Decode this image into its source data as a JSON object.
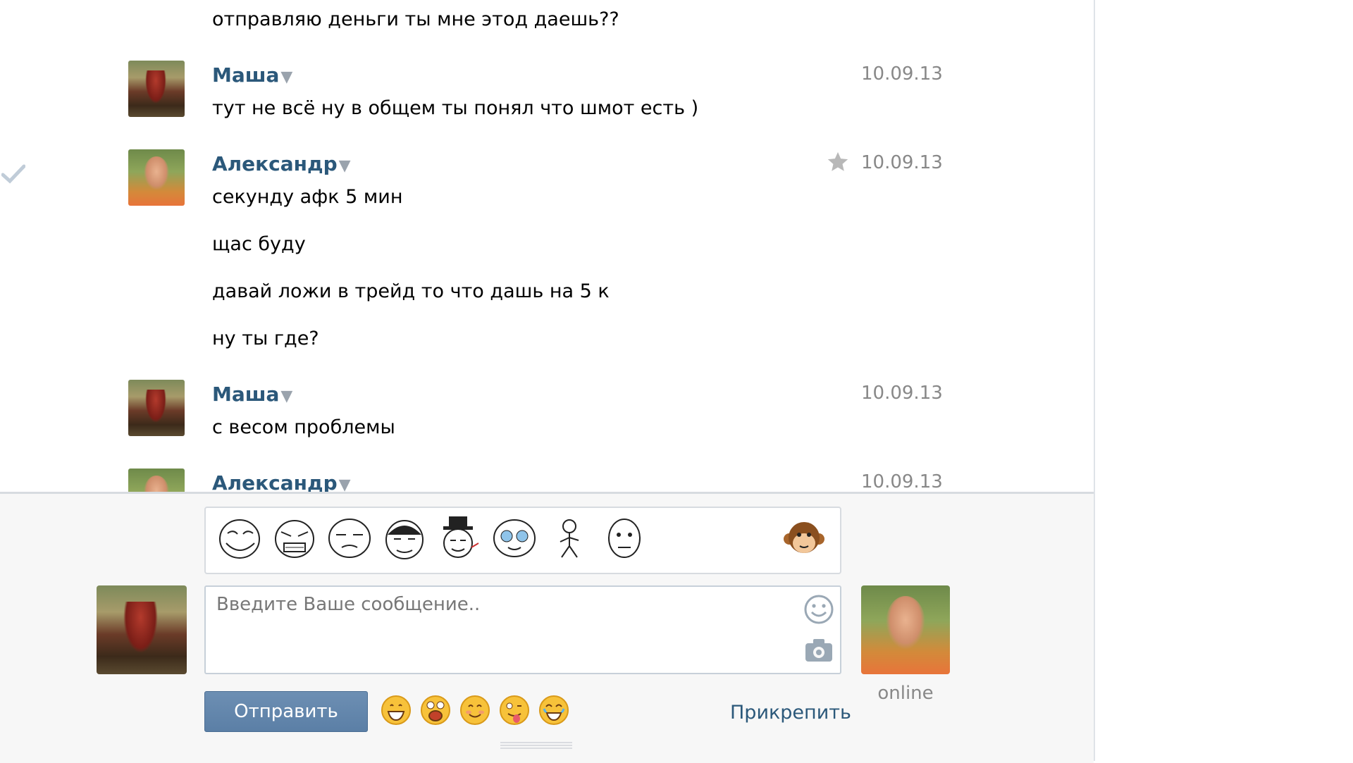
{
  "messages": [
    {
      "author": "",
      "date": "",
      "lines": [
        "отправляю деньги ты мне этод даешь??"
      ]
    },
    {
      "author": "Маша",
      "date": "10.09.13",
      "lines": [
        "тут не всё ну в общем ты понял что шмот есть )"
      ]
    },
    {
      "author": "Александр",
      "date": "10.09.13",
      "lines": [
        "секунду афк 5 мин",
        "щас буду",
        "давай ложи в трейд то что дашь на 5 к",
        "ну ты где?"
      ]
    },
    {
      "author": "Маша",
      "date": "10.09.13",
      "lines": [
        "с весом проблемы"
      ]
    },
    {
      "author": "Александр",
      "date": "10.09.13",
      "lines": []
    }
  ],
  "composer": {
    "placeholder": "Введите Ваше сообщение..",
    "send_label": "Отправить",
    "attach_label": "Прикрепить",
    "peer_status": "online"
  },
  "stickers": [
    "troll-face-sticker",
    "rage-face-sticker",
    "meh-face-sticker",
    "yao-ming-sticker",
    "like-a-sir-sticker",
    "cute-tears-sticker",
    "stick-figure-sticker",
    "poker-face-sticker",
    "monkey-sticker"
  ],
  "emoji": [
    "grin-emoji",
    "surprised-emoji",
    "smile-emoji",
    "tongue-emoji",
    "cry-laugh-emoji"
  ],
  "colors": {
    "link": "#2b587a",
    "date": "#888888",
    "button": "#5b7fa6",
    "background": "#f7f7f7"
  }
}
